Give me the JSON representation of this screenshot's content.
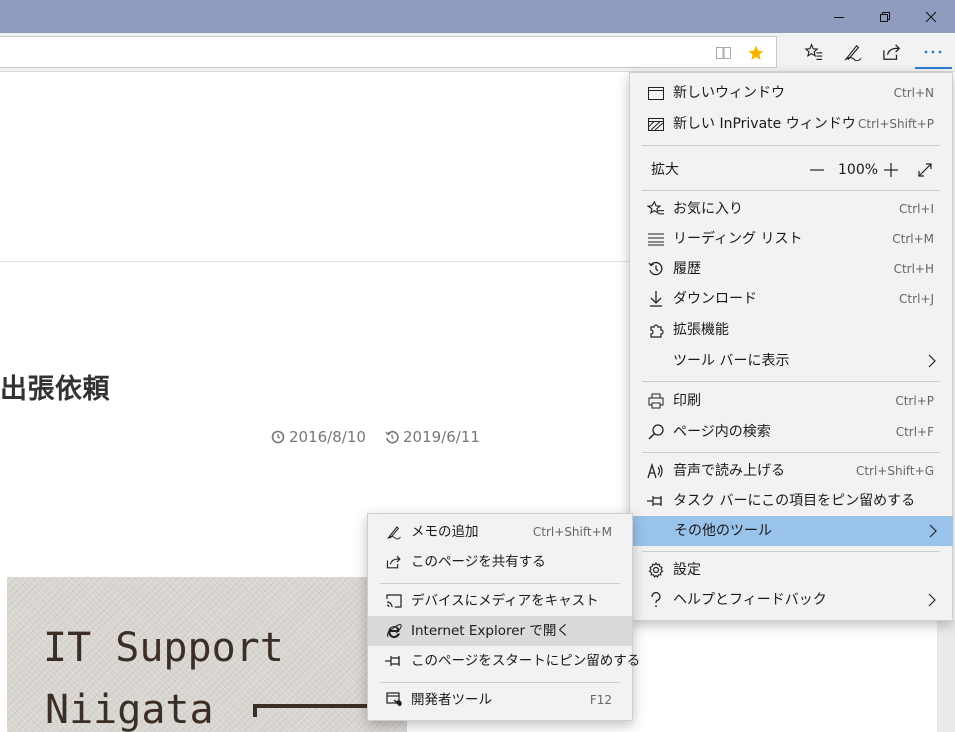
{
  "colors": {
    "titlebar": "#8f9cbf",
    "accent": "#2b7cd3",
    "menu_bg": "#f2f2f2",
    "menu_highlight": "#99c3ea",
    "star": "#f7b500"
  },
  "window_controls": {
    "minimize_icon": "minimize-icon",
    "restore_icon": "restore-icon",
    "close_icon": "close-icon"
  },
  "toolbar": {
    "icons": [
      "reading-view-icon",
      "favorite-star-icon",
      "favorites-hub-icon",
      "web-note-icon",
      "share-icon",
      "more-icon"
    ]
  },
  "article": {
    "title": "出張依頼",
    "published": "2016/8/10",
    "updated": "2019/6/11",
    "hero_text_line1": "IT Support",
    "hero_text_line2": "Niigata"
  },
  "main_menu": {
    "new_window": {
      "label": "新しいウィンドウ",
      "shortcut": "Ctrl+N",
      "icon": "window-icon"
    },
    "new_inprivate": {
      "label": "新しい InPrivate ウィンドウ",
      "shortcut": "Ctrl+Shift+P",
      "icon": "inprivate-icon"
    },
    "zoom": {
      "label": "拡大",
      "value": "100%",
      "minus": "—",
      "plus": "+"
    },
    "favorites": {
      "label": "お気に入り",
      "shortcut": "Ctrl+I",
      "icon": "favorites-icon"
    },
    "reading_list": {
      "label": "リーディング リスト",
      "shortcut": "Ctrl+M",
      "icon": "reading-list-icon"
    },
    "history": {
      "label": "履歴",
      "shortcut": "Ctrl+H",
      "icon": "history-icon"
    },
    "downloads": {
      "label": "ダウンロード",
      "shortcut": "Ctrl+J",
      "icon": "download-icon"
    },
    "extensions": {
      "label": "拡張機能",
      "icon": "extensions-icon"
    },
    "show_in_toolbar": {
      "label": "ツール バーに表示"
    },
    "print": {
      "label": "印刷",
      "shortcut": "Ctrl+P",
      "icon": "print-icon"
    },
    "find": {
      "label": "ページ内の検索",
      "shortcut": "Ctrl+F",
      "icon": "search-icon"
    },
    "read_aloud": {
      "label": "音声で読み上げる",
      "shortcut": "Ctrl+Shift+G",
      "icon": "read-aloud-icon"
    },
    "pin_taskbar": {
      "label": "タスク バーにこの項目をピン留めする",
      "icon": "pin-icon"
    },
    "more_tools": {
      "label": "その他のツール"
    },
    "settings": {
      "label": "設定",
      "icon": "settings-icon"
    },
    "help": {
      "label": "ヘルプとフィードバック",
      "icon": "help-icon"
    }
  },
  "sub_menu": {
    "add_notes": {
      "label": "メモの追加",
      "shortcut": "Ctrl+Shift+M",
      "icon": "pen-icon"
    },
    "share_page": {
      "label": "このページを共有する",
      "icon": "share-icon"
    },
    "cast_media": {
      "label": "デバイスにメディアをキャスト",
      "icon": "cast-icon"
    },
    "open_ie": {
      "label": "Internet Explorer で開く",
      "icon": "ie-icon"
    },
    "pin_start": {
      "label": "このページをスタートにピン留めする",
      "icon": "pin-icon"
    },
    "dev_tools": {
      "label": "開発者ツール",
      "shortcut": "F12",
      "icon": "devtools-icon"
    }
  }
}
